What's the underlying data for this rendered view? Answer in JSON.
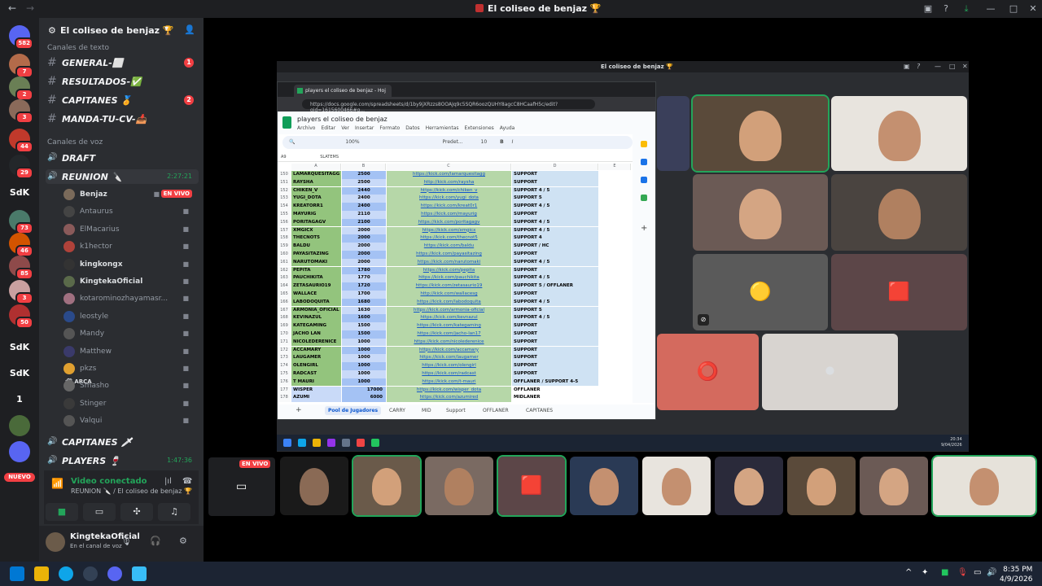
{
  "window": {
    "title": "El coliseo de benjaz 🏆",
    "back": "←",
    "forward": "→"
  },
  "rail": {
    "servers": [
      {
        "label": "",
        "badge": "582",
        "color": "#5865f2"
      },
      {
        "label": "",
        "badge": "7",
        "color": "#b36b4a"
      },
      {
        "label": "",
        "badge": "2",
        "color": "#6a7f55"
      },
      {
        "label": "",
        "badge": "3",
        "color": "#8a6a5a"
      },
      {
        "label": "",
        "badge": "44",
        "color": "#c0392b"
      },
      {
        "label": "",
        "badge": "29",
        "color": "#23272a"
      },
      {
        "label": "SdK",
        "badge": "",
        "color": "#2b2d31"
      },
      {
        "label": "",
        "badge": "73",
        "color": "#4a7a6a"
      },
      {
        "label": "",
        "badge": "46",
        "color": "#d35400"
      },
      {
        "label": "",
        "badge": "85",
        "color": "#8e4a4a"
      },
      {
        "label": "",
        "badge": "3",
        "color": "#c9a0a0"
      },
      {
        "label": "",
        "badge": "50",
        "color": "#b03030"
      },
      {
        "label": "SdK",
        "badge": "",
        "color": "#2b2d31"
      },
      {
        "label": "SdK",
        "badge": "",
        "color": "#2b2d31"
      },
      {
        "label": "1",
        "badge": "",
        "color": "#2b2d31"
      },
      {
        "label": "",
        "badge": "",
        "color": "#4a6a3a"
      },
      {
        "label": "",
        "badge": "",
        "color": "#5865f2"
      }
    ],
    "nuevo": "NUEVO"
  },
  "guild": {
    "name": "El coliseo de benjaz 🏆",
    "text_category": "Canales de texto",
    "voice_category": "Canales de voz",
    "text_channels": [
      {
        "name": "GENERAL-⬜",
        "count": "1"
      },
      {
        "name": "RESULTADOS-✅",
        "count": ""
      },
      {
        "name": "CAPITANES 🏅",
        "count": "2"
      },
      {
        "name": "MANDA-TU-CV-📥",
        "count": ""
      }
    ],
    "voice_channels": [
      {
        "name": "DRAFT",
        "timer": ""
      },
      {
        "name": "REUNION 🔪",
        "timer": "2:27:21"
      },
      {
        "name": "CAPITANES 🗡",
        "timer": ""
      },
      {
        "name": "PLAYERS 🍷",
        "timer": "1:47:36"
      }
    ],
    "members": [
      {
        "name": "Benjaz",
        "live": "EN VIVO",
        "bold": true,
        "tag": "",
        "color": "#7a6a5a"
      },
      {
        "name": "Antaurus",
        "live": "",
        "bold": false,
        "tag": "",
        "color": "#444"
      },
      {
        "name": "ElMacarius",
        "live": "",
        "bold": false,
        "tag": "",
        "color": "#8a5a5a"
      },
      {
        "name": "k1hector",
        "live": "",
        "bold": false,
        "tag": "",
        "color": "#b0423a"
      },
      {
        "name": "kingkongx",
        "live": "",
        "bold": true,
        "tag": "",
        "color": "#333"
      },
      {
        "name": "KingtekaOficial",
        "live": "",
        "bold": true,
        "tag": "",
        "color": "#5a6a4a"
      },
      {
        "name": "kotarominozhayamasr...",
        "live": "",
        "bold": false,
        "tag": "",
        "color": "#a07080"
      },
      {
        "name": "leostyle",
        "live": "",
        "bold": false,
        "tag": "",
        "color": "#2a4a8a"
      },
      {
        "name": "Mandy",
        "live": "",
        "bold": false,
        "tag": "",
        "color": "#555"
      },
      {
        "name": "Matthew",
        "live": "",
        "bold": false,
        "tag": "",
        "color": "#3a3a6a"
      },
      {
        "name": "pkzs",
        "live": "",
        "bold": false,
        "tag": "",
        "color": "#e0a030"
      },
      {
        "name": "Smasho",
        "live": "",
        "bold": false,
        "tag": "🛠 ARCA",
        "color": "#666"
      },
      {
        "name": "Stinger",
        "live": "",
        "bold": false,
        "tag": "",
        "color": "#3a3a3a"
      },
      {
        "name": "Valqui",
        "live": "",
        "bold": false,
        "tag": "",
        "color": "#555"
      }
    ]
  },
  "voice_panel": {
    "status": "Video conectado",
    "location": "REUNION 🔪 / El coliseo de benjaz 🏆",
    "stream_badge": "EN VIVO"
  },
  "user": {
    "name": "KingtekaOficial",
    "status": "En el canal de voz"
  },
  "inner_window": {
    "title": "El coliseo de benjaz 🏆"
  },
  "browser": {
    "tab": "players el coliseo de benjaz - Hoj",
    "url": "https://docs.google.com/spreadsheets/d/1by9jXRzzs8OOAJq9c5SQR6oozQUHY8agcC8HCaafH5c/edit?gid=1615600466#g...",
    "doc_title": "players el coliseo de benjaz",
    "menu": [
      "Archivo",
      "Editar",
      "Ver",
      "Insertar",
      "Formato",
      "Datos",
      "Herramientas",
      "Extensiones",
      "Ayuda"
    ],
    "zoom": "100%",
    "font": "Predet...",
    "font_size": "10",
    "cell_ref": "A9",
    "formula": "SLATEMS",
    "col_headers": [
      "A",
      "B",
      "C",
      "D",
      "E"
    ],
    "rows": [
      {
        "n": "150",
        "name": "LAMARQUESITAGG",
        "mmr": "2500",
        "link": "https://kick.com/lamarquesitagg",
        "role": "SUPPORT"
      },
      {
        "n": "151",
        "name": "RAYSHA",
        "mmr": "2500",
        "link": "http://kick.com/raysha",
        "role": "SUPPORT"
      },
      {
        "n": "152",
        "name": "CHIKEN_V",
        "mmr": "2440",
        "link": "https://kick.com/chiken_v",
        "role": "SUPPORT 4 / 5"
      },
      {
        "n": "153",
        "name": "YUGI_DOTA",
        "mmr": "2400",
        "link": "https://kick.com/yugi_dota",
        "role": "SUPPORT 5"
      },
      {
        "n": "154",
        "name": "KREATORR1",
        "mmr": "2400",
        "link": "https://kick.com/kreat0r1",
        "role": "SUPPORT 4 / 5"
      },
      {
        "n": "155",
        "name": "MAYURIG",
        "mmr": "2110",
        "link": "https://kick.com/mayurig",
        "role": "SUPPORT"
      },
      {
        "n": "156",
        "name": "PORITAGAGV",
        "mmr": "2100",
        "link": "https://kick.com/poritagagv",
        "role": "SUPPORT 4 / 5"
      },
      {
        "n": "157",
        "name": "XMGICX",
        "mmr": "2000",
        "link": "https://kick.com/xmgicx",
        "role": "SUPPORT 4 / 5"
      },
      {
        "n": "158",
        "name": "THECNOT5",
        "mmr": "2000",
        "link": "https://kick.com/thecnot5",
        "role": "SUPPORT 4"
      },
      {
        "n": "159",
        "name": "BALDU",
        "mmr": "2000",
        "link": "https://kick.com/baldu",
        "role": "SUPPORT / HC"
      },
      {
        "n": "160",
        "name": "PAYASITAZING",
        "mmr": "2000",
        "link": "https://kick.com/payasitazing",
        "role": "SUPPORT"
      },
      {
        "n": "161",
        "name": "NARUTOMAKI",
        "mmr": "2000",
        "link": "https://kick.com/narutomaki",
        "role": "SUPPORT 4 / 5"
      },
      {
        "n": "162",
        "name": "PEPITA",
        "mmr": "1780",
        "link": "https://kick.com/pepita",
        "role": "SUPPORT"
      },
      {
        "n": "163",
        "name": "PAUCHIKITA",
        "mmr": "1770",
        "link": "https://kick.com/pauchikita",
        "role": "SUPPORT 4 / 5"
      },
      {
        "n": "164",
        "name": "ZETASAURIO19",
        "mmr": "1720",
        "link": "https://kick.com/zetasaurio19",
        "role": "SUPPORT 5 / OFFLANER"
      },
      {
        "n": "165",
        "name": "WALLACE",
        "mmr": "1700",
        "link": "http://kick.com/wallacesg",
        "role": "SUPPORT"
      },
      {
        "n": "166",
        "name": "LABODOQUITA",
        "mmr": "1680",
        "link": "https://kick.com/labodoquita",
        "role": "SUPPORT 4 / 5"
      },
      {
        "n": "167",
        "name": "ARMONIA_OFICIAL",
        "mmr": "1630",
        "link": "https://kick.com/armonia-oficial",
        "role": "SUPPORT 5"
      },
      {
        "n": "168",
        "name": "KEVINAZUL",
        "mmr": "1600",
        "link": "https://kick.com/kevnazul",
        "role": "SUPPORT 4 / 5"
      },
      {
        "n": "169",
        "name": "KATEGAMING",
        "mmr": "1500",
        "link": "https://kick.com/kategaming",
        "role": "SUPPORT"
      },
      {
        "n": "170",
        "name": "JACHO LAN",
        "mmr": "1500",
        "link": "https://kick.com/jacho-lan17",
        "role": "SUPPORT"
      },
      {
        "n": "171",
        "name": "NICOLEDERENICE",
        "mmr": "1000",
        "link": "https://kick.com/nicolederenice",
        "role": "SUPPORT"
      },
      {
        "n": "172",
        "name": "ACCAMARY",
        "mmr": "1000",
        "link": "https://kick.com/accamary",
        "role": "SUPPORT"
      },
      {
        "n": "173",
        "name": "LAUGAMER",
        "mmr": "1000",
        "link": "https://kick.com/laugamer",
        "role": "SUPPORT"
      },
      {
        "n": "174",
        "name": "OLENGIRL",
        "mmr": "1000",
        "link": "https://kick.com/olengirl",
        "role": "SUPPORT"
      },
      {
        "n": "175",
        "name": "RADCAST",
        "mmr": "1000",
        "link": "https://kick.com/radcast",
        "role": "SUPPORT"
      },
      {
        "n": "176",
        "name": "T MAURI",
        "mmr": "1000",
        "link": "https://kick.com/t-mauri",
        "role": "OFFLANER / SUPPORT 4-5"
      },
      {
        "n": "177",
        "name": "WISPER",
        "mmr": "17000",
        "link": "https://kick.com/wisper_dota",
        "role": "OFFLANER"
      },
      {
        "n": "178",
        "name": "AZUMI",
        "mmr": "6000",
        "link": "https://kick.com/azumired",
        "role": "MIDLANER"
      }
    ],
    "sheet_tabs": [
      "Pool de Jugadores",
      "CARRY",
      "MID",
      "Support",
      "OFFLANER",
      "CAPITANES"
    ],
    "inner_clock_time": "20:34",
    "inner_clock_date": "9/04/2026"
  },
  "taskbar": {
    "time": "8:35 PM",
    "date": "4/9/2026"
  },
  "colors": {
    "discord_bg": "#2b2d31",
    "rail_bg": "#1e1f22",
    "accent_green": "#23a55a",
    "live_red": "#f23f43"
  }
}
